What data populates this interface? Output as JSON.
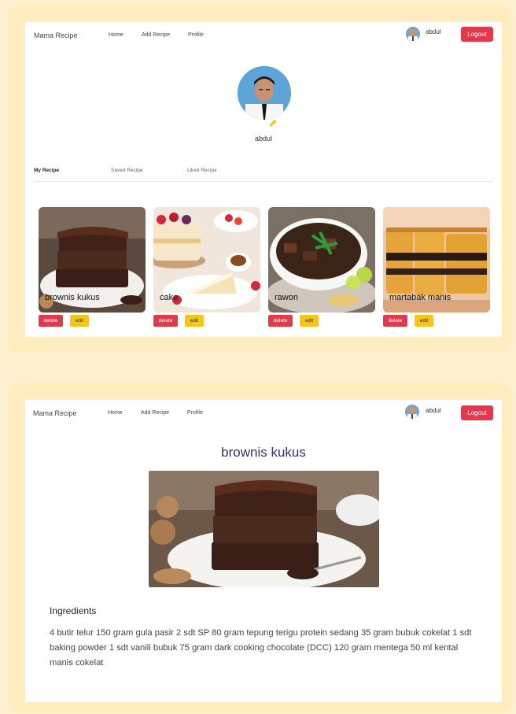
{
  "app": {
    "brand": "Mama Recipe",
    "nav": [
      "Home",
      "Add Recipe",
      "Profile"
    ],
    "user_name": "abdul",
    "logout_label": "Logout"
  },
  "profile": {
    "name": "abdul",
    "tabs": [
      "My Recipe",
      "Saved Recipe",
      "Liked Recipe"
    ],
    "active_tab": "My Recipe"
  },
  "recipes": [
    {
      "title": "brownis kukus",
      "delete": "delete",
      "edit": "edit"
    },
    {
      "title": "cake",
      "delete": "delete",
      "edit": "edit"
    },
    {
      "title": "rawon",
      "delete": "delete",
      "edit": "edit"
    },
    {
      "title": "martabak manis",
      "delete": "delete",
      "edit": "edit"
    }
  ],
  "detail": {
    "title": "brownis kukus",
    "ingredients_heading": "Ingredients",
    "ingredients_text": "4 butir telur 150 gram gula pasir 2 sdt SP 80 gram tepung terigu protein sedang 35 gram bubuk cokelat 1 sdt baking powder 1 sdt vanili bubuk 75 gram dark cooking chocolate (DCC) 120 gram mentega 50 ml kental manis cokelat"
  },
  "colors": {
    "accent_red": "#e23a4c",
    "accent_yellow": "#f5c518",
    "title_purple": "#3b2f6b",
    "frame": "#ffecbf"
  }
}
